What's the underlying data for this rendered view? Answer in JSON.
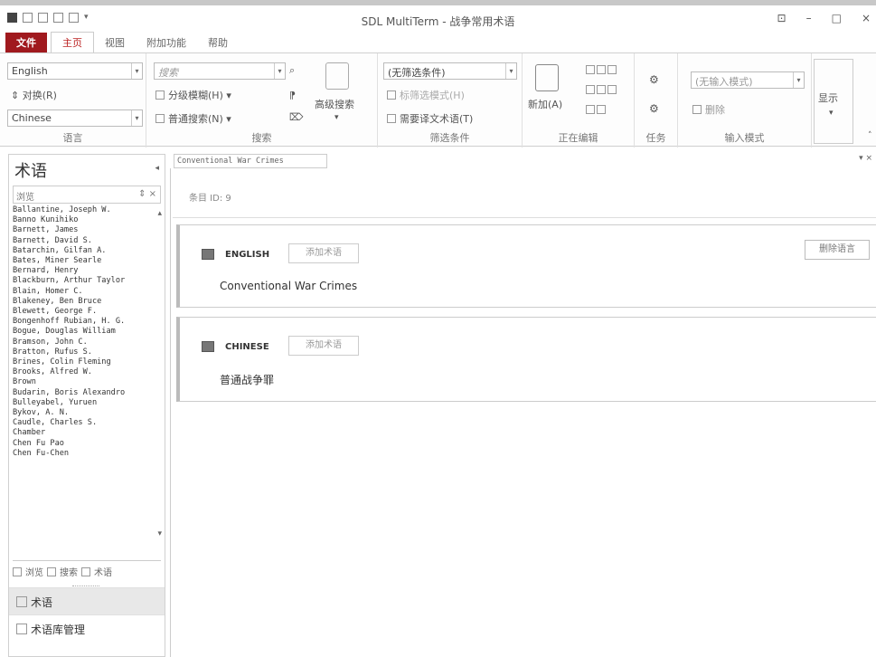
{
  "window": {
    "title": "SDL MultiTerm - 战争常用术语",
    "buttons": [
      "⊡",
      "–",
      "□",
      "×"
    ]
  },
  "ribbon": {
    "tabs": [
      "文件",
      "主页",
      "视图",
      "附加功能",
      "帮助"
    ],
    "language_group": {
      "source_value": "English",
      "switch_label": "⇕ 对换(R)",
      "target_value": "Chinese",
      "label": "语言"
    },
    "search_group": {
      "search_placeholder": "搜索",
      "fuzzy_label": "分级模糊(H) ▾",
      "normal_label": "普通搜索(N) ▾",
      "advanced_label": "高级搜索",
      "label": "搜索"
    },
    "filter_group": {
      "filter_value": "(无筛选条件)",
      "highlight_label": "标筛选模式(H)",
      "full_text_label": "需要译文术语(T)",
      "label": "筛选条件"
    },
    "editing_group": {
      "new_label": "新加(A)",
      "label": "正在编辑"
    },
    "tasks_group": {
      "label": "任务"
    },
    "input_group": {
      "mode_value": "(无输入模式)",
      "delete_label": "删除",
      "label": "输入模式"
    },
    "display_group": {
      "label": "显示"
    }
  },
  "left_pane": {
    "title": "术语",
    "search_placeholder": "浏览",
    "search_controls": "⇕ ×",
    "terms": [
      "Ballantine, Joseph W.",
      "Banno Kunihiko",
      "Barnett, James",
      "Barnett, David S.",
      "Batarchin, Gilfan A.",
      "Bates, Miner Searle",
      "Bernard, Henry",
      "Blackburn, Arthur Taylor",
      "Blain, Homer C.",
      "Blakeney, Ben Bruce",
      "Blewett, George F.",
      "Bongenhoff Rubian, H. G.",
      "Bogue, Douglas William",
      "Bramson, John C.",
      "Bratton, Rufus S.",
      "Brines, Colin Fleming",
      "Brooks, Alfred W.",
      "Brown",
      "Budarin, Boris Alexandro",
      "Bulleyabel, Yuruen",
      "Bykov, A. N.",
      "Caudle, Charles S.",
      "Chamber",
      "Chen Fu Pao",
      "Chen Fu-Chen"
    ],
    "bottom_tabs": [
      "浏览",
      "搜索",
      "术语"
    ],
    "nav": [
      "术语",
      "术语库管理"
    ]
  },
  "document": {
    "tab_title": "Conventional War Crimes",
    "entry_label": "条目 ID: 9",
    "languages": [
      {
        "name": "ENGLISH",
        "add_term": "添加术语",
        "delete_language": "删除语言",
        "term": "Conventional War Crimes"
      },
      {
        "name": "CHINESE",
        "add_term": "添加术语",
        "term": "普通战争罪"
      }
    ]
  }
}
